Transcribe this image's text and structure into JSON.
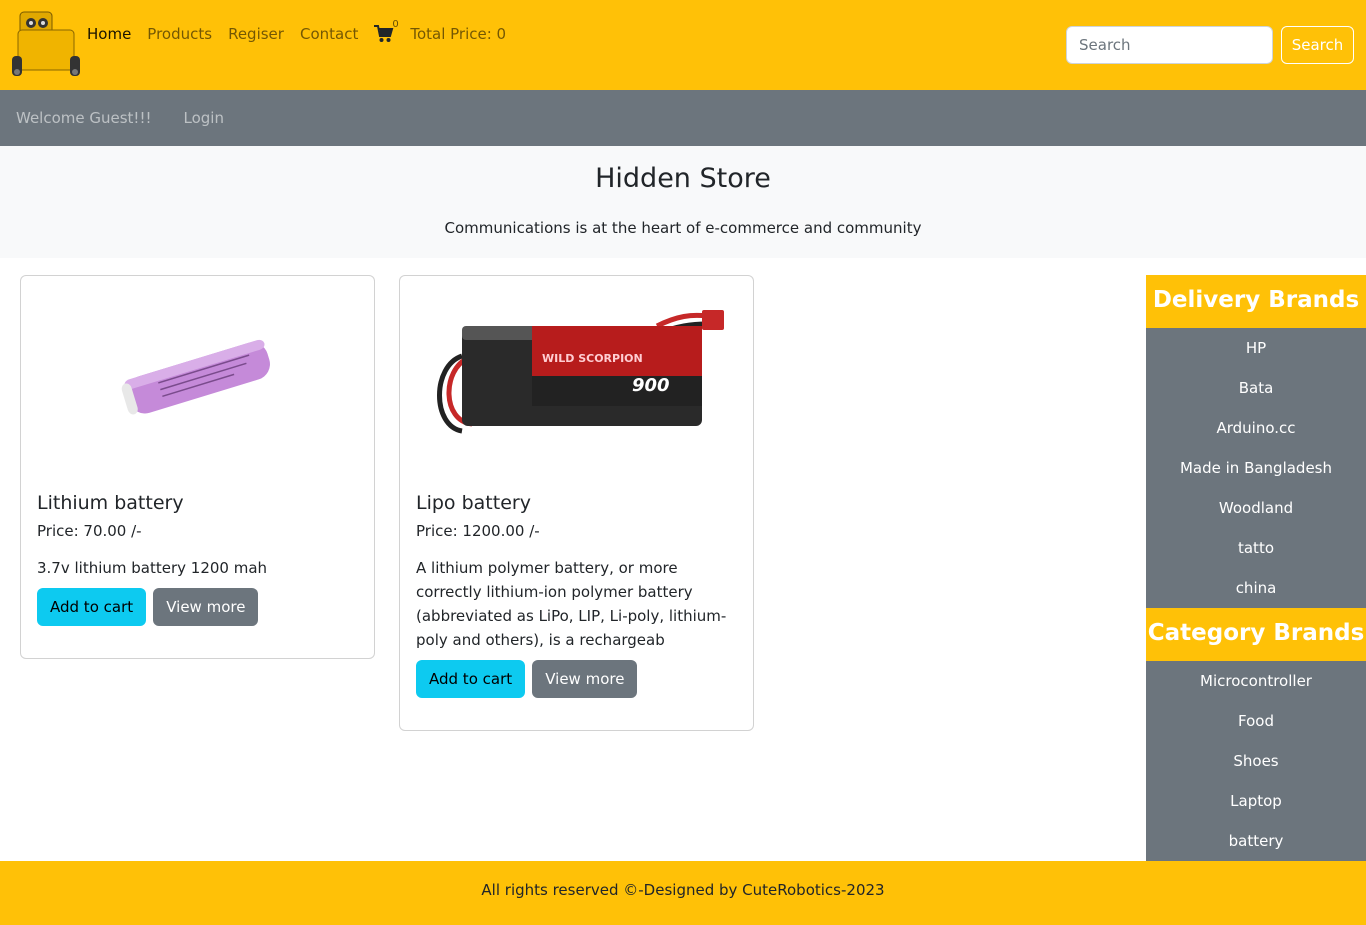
{
  "navbar": {
    "links": [
      "Home",
      "Products",
      "Regiser",
      "Contact"
    ],
    "cart_count": "0",
    "total_price": "Total Price: 0",
    "search_placeholder": "Search",
    "search_button": "Search"
  },
  "subbar": {
    "welcome": "Welcome Guest!!!",
    "login": "Login"
  },
  "hero": {
    "title": "Hidden Store",
    "subtitle": "Communications is at the heart of e-commerce and community"
  },
  "products": [
    {
      "title": "Lithium battery",
      "price": "Price: 70.00 /-",
      "description": "3.7v lithium battery 1200 mah",
      "add_to_cart": "Add to cart",
      "view_more": "View more"
    },
    {
      "title": "Lipo battery",
      "price": "Price: 1200.00 /-",
      "description": "A lithium polymer battery, or more correctly lithium-ion polymer battery (abbreviated as LiPo, LIP, Li-poly, lithium-poly and others), is a rechargeab",
      "image_text": "900",
      "add_to_cart": "Add to cart",
      "view_more": "View more"
    }
  ],
  "sidebar": {
    "delivery_heading": "Delivery Brands",
    "delivery_brands": [
      "HP",
      "Bata",
      "Arduino.cc",
      "Made in Bangladesh",
      "Woodland",
      "tatto",
      "china"
    ],
    "category_heading": "Category Brands",
    "categories": [
      "Microcontroller",
      "Food",
      "Shoes",
      "Laptop",
      "battery"
    ]
  },
  "footer": {
    "text": "All rights reserved ©-Designed by CuteRobotics-2023"
  },
  "colors": {
    "primary": "#ffc107",
    "secondary": "#6c757d",
    "info": "#0dcaf0",
    "light": "#f8f9fa"
  }
}
